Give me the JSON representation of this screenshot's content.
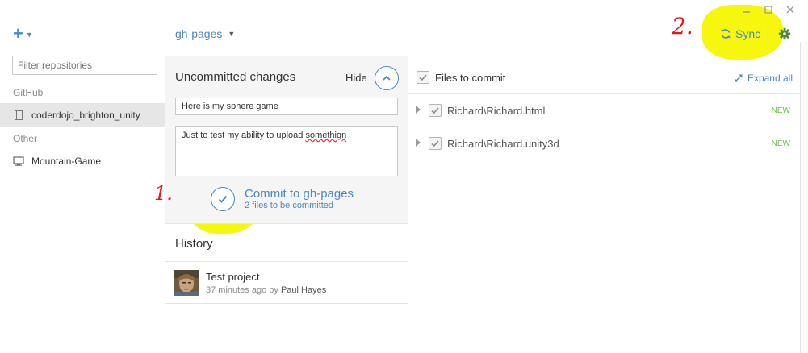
{
  "colors": {
    "accent": "#4a88c7",
    "new_badge": "#6cc04a",
    "highlight": "#f7f700",
    "annotation": "#e01818",
    "sync_icon": "#4a88c7",
    "gear_icon": "#4f8a3a"
  },
  "sidebar": {
    "add_icon": "plus-icon",
    "filter_placeholder": "Filter repositories",
    "groups": [
      {
        "label": "GitHub",
        "repos": [
          {
            "name": "coderdojo_brighton_unity",
            "icon": "book-icon",
            "selected": true
          }
        ]
      },
      {
        "label": "Other",
        "repos": [
          {
            "name": "Mountain-Game",
            "icon": "monitor-icon",
            "selected": false
          }
        ]
      }
    ]
  },
  "header": {
    "branch": "gh-pages",
    "sync_label": "Sync",
    "window_controls": [
      "minimize-icon",
      "maximize-icon",
      "close-icon"
    ]
  },
  "changes": {
    "title": "Uncommitted changes",
    "hide_label": "Hide",
    "summary_value": "Here is my sphere game",
    "description_value": "Just to test my ability to upload somethign",
    "description_prefix": "Just to test my ability to upload ",
    "description_misspelled": "somethign",
    "commit_label": "Commit to gh-pages",
    "commit_sub": "2 files to be committed"
  },
  "history": {
    "title": "History",
    "items": [
      {
        "title": "Test project",
        "time": "37 minutes ago",
        "by": "by",
        "author": "Paul Hayes"
      }
    ]
  },
  "files": {
    "header_label": "Files to commit",
    "expand_label": "Expand all",
    "items": [
      {
        "name": "Richard\\Richard.html",
        "status": "NEW",
        "checked": true
      },
      {
        "name": "Richard\\Richard.unity3d",
        "status": "NEW",
        "checked": true
      }
    ]
  },
  "annotations": {
    "step1": "1.",
    "step2": "2."
  }
}
